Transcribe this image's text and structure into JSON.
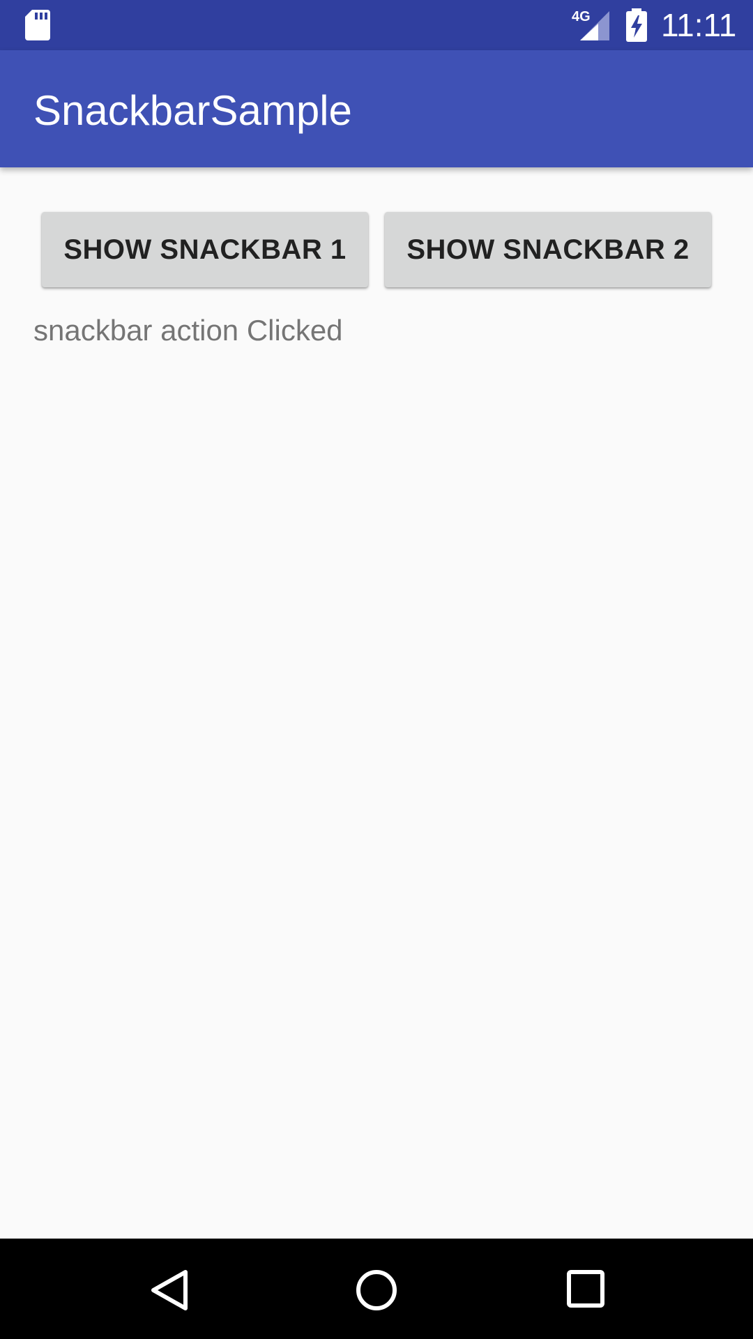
{
  "status_bar": {
    "time": "11:11",
    "network_label": "4G",
    "icons": [
      "sd-card-icon",
      "signal-4g-icon",
      "battery-charging-icon"
    ],
    "background_color": "#303f9f"
  },
  "app_bar": {
    "title": "SnackbarSample",
    "background_color": "#3f51b5"
  },
  "main": {
    "buttons": [
      {
        "label": "SHOW SNACKBAR 1"
      },
      {
        "label": "SHOW SNACKBAR 2"
      }
    ],
    "status_text": "snackbar action Clicked"
  },
  "nav_bar": {
    "icons": [
      "back-icon",
      "home-icon",
      "recents-icon"
    ]
  }
}
